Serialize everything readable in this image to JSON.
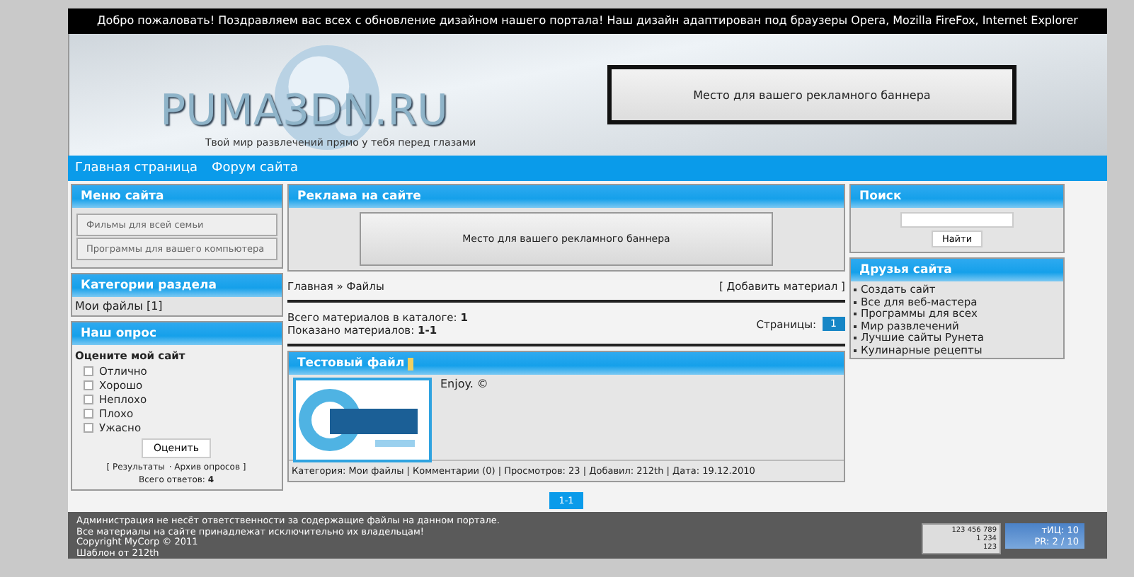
{
  "top_bar": {
    "text": "Добро пожаловать! Поздравляем вас всех с обновление дизайном нашего портала! Наш дизайн адаптирован под браузеры Opera, Mozilla FireFox, Internet Explorer"
  },
  "header": {
    "logo": "PUMA3DN.RU",
    "slogan": "Твой мир развлечений прямо у тебя перед глазами",
    "banner": "Место для вашего рекламного баннера"
  },
  "nav": [
    {
      "label": "Главная страница"
    },
    {
      "label": "Форум сайта"
    }
  ],
  "left": {
    "menu": {
      "title": "Меню сайта",
      "items": [
        "Фильмы для всей семьи",
        "Программы для вашего компьютера"
      ]
    },
    "categories": {
      "title": "Категории раздела",
      "items": [
        "Мои файлы [1]"
      ]
    },
    "poll": {
      "title": "Наш опрос",
      "question": "Оцените мой сайт",
      "options": [
        {
          "label": "Отлично",
          "selected": false
        },
        {
          "label": "Хорошо",
          "selected": false
        },
        {
          "label": "Неплохо",
          "selected": false
        },
        {
          "label": "Плохо",
          "selected": false
        },
        {
          "label": "Ужасно",
          "selected": false
        }
      ],
      "button": "Оценить",
      "results": "[ Результаты",
      "archive": "· Архив опросов ]",
      "total_label": "Всего ответов:",
      "total": "4"
    }
  },
  "center": {
    "ad_title": "Реклама на сайте",
    "ad_banner": "Место для вашего рекламного баннера",
    "breadcrumb": "Главная » Файлы",
    "add_link": "[ Добавить материал ]",
    "stats": [
      "Всего материалов в каталоге: **1**",
      "Показано материалов: **1-1**"
    ],
    "pages_label": "Страницы:",
    "current_page": "1",
    "entry": {
      "title": "Тестовый файл",
      "text": "Enjoy. ©",
      "details": "Категория: Мои файлы | Комментарии (0) | Просмотров: 23 | Добавил: 212th | Дата: 19.12.2010"
    },
    "pager": "1-1"
  },
  "right": {
    "search": {
      "title": "Поиск",
      "button": "Найти"
    },
    "friends": {
      "title": "Друзья сайта",
      "items": [
        "Создать сайт",
        "Все для веб-мастера",
        "Программы для всех",
        "Мир развлечений",
        "Лучшие сайты Рунета",
        "Кулинарные рецепты"
      ]
    }
  },
  "footer": {
    "lines": [
      "Администрация не несёт ответственности за содержащие файлы на данном портале.",
      "Все материалы на сайте принадлежат исключительно их владельцам!",
      "Copyright MyCorp © 2011",
      "Шаблон от 212th"
    ],
    "counter": {
      "total": "123 456 789",
      "hits": "1 234",
      "hosts": "123"
    },
    "rank": {
      "tic": "тИЦ: 10",
      "pr": "PR: 2 / 10"
    }
  }
}
